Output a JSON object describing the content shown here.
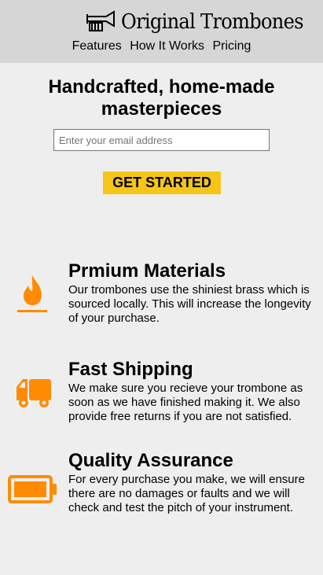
{
  "header": {
    "brand": "Original Trombones",
    "logo_icon": "trombone-icon",
    "nav": [
      "Features",
      "How It Works",
      "Pricing"
    ]
  },
  "hero": {
    "title": "Handcrafted, home-made masterpieces",
    "email_placeholder": "Enter your email address",
    "cta_label": "GET STARTED"
  },
  "colors": {
    "accent": "#ff8c00",
    "cta_bg": "#f5c518",
    "header_bg": "#d6d6d6",
    "page_bg": "#eeeeee"
  },
  "features": [
    {
      "icon": "fire-icon",
      "title": "Prmium Materials",
      "description": "Our trombones use the shiniest brass which is sourced locally. This will increase the longevity of your purchase."
    },
    {
      "icon": "truck-icon",
      "title": "Fast Shipping",
      "description": "We make sure you recieve your trombone as soon as we have finished making it. We also provide free returns if you are not satisfied."
    },
    {
      "icon": "battery-full-icon",
      "title": "Quality Assurance",
      "description": "For every purchase you make, we will ensure there are no damages or faults and we will check and test the pitch of your instrument."
    }
  ]
}
